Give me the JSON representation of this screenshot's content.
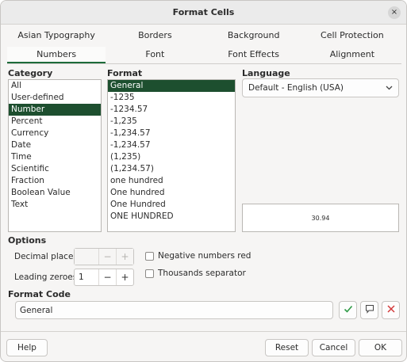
{
  "window": {
    "title": "Format Cells",
    "close_glyph": "×"
  },
  "tabs_row1": [
    "Asian Typography",
    "Borders",
    "Background",
    "Cell Protection"
  ],
  "tabs_row2": [
    "Numbers",
    "Font",
    "Font Effects",
    "Alignment"
  ],
  "category": {
    "label": "Category",
    "items": [
      "All",
      "User-defined",
      "Number",
      "Percent",
      "Currency",
      "Date",
      "Time",
      "Scientific",
      "Fraction",
      "Boolean Value",
      "Text"
    ],
    "selected": "Number"
  },
  "format": {
    "label": "Format",
    "items": [
      "General",
      "-1235",
      "-1234.57",
      "-1,235",
      "-1,234.57",
      "-1,234.57",
      "(1,235)",
      "(1,234.57)",
      "one hundred",
      "One hundred",
      "One Hundred",
      "ONE HUNDRED"
    ],
    "selected": "General"
  },
  "language": {
    "label": "Language",
    "value": "Default - English (USA)"
  },
  "preview": {
    "value": "30.94"
  },
  "options": {
    "label": "Options",
    "decimal_places": {
      "label": "Decimal places:",
      "value": ""
    },
    "leading_zeroes": {
      "label": "Leading zeroes:",
      "value": "1"
    },
    "negative_red": {
      "label": "Negative numbers red",
      "checked": false
    },
    "thousands_sep": {
      "label": "Thousands separator",
      "checked": false
    },
    "minus": "−",
    "plus": "+"
  },
  "format_code": {
    "label": "Format Code",
    "value": "General"
  },
  "buttons": {
    "help": "Help",
    "reset": "Reset",
    "cancel": "Cancel",
    "ok": "OK"
  },
  "colors": {
    "accent": "#1d4f2f",
    "check_green": "#2e9a45",
    "delete_red": "#d33b3b"
  }
}
